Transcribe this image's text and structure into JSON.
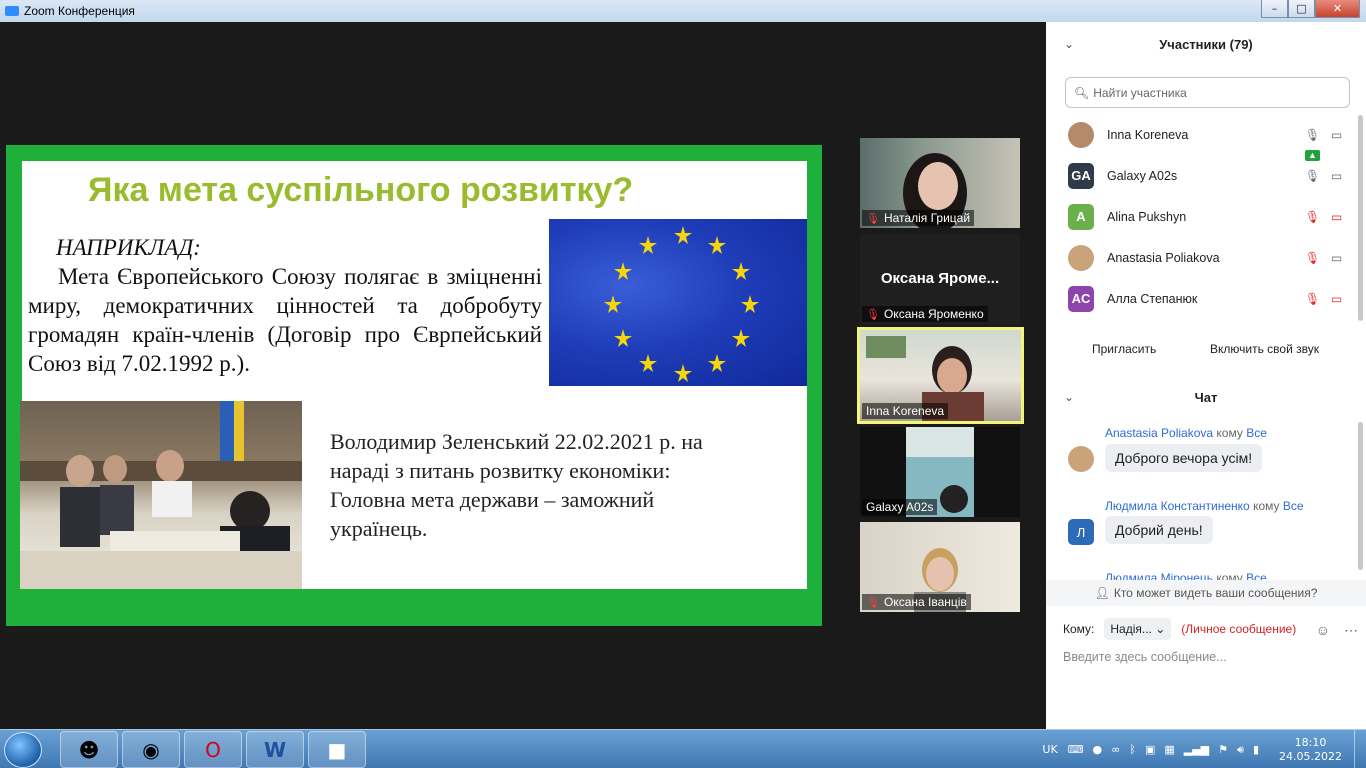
{
  "window": {
    "title": "Zoom Конференция",
    "min": "–",
    "max": "□",
    "close": "✕"
  },
  "slide": {
    "title": "Яка мета суспільного розвитку?",
    "lead": "НАПРИКЛАД:",
    "body": "Мета Європейського Союзу полягає в зміцненні миру, демократичних цінностей та добробуту громадян країн-членів (Договір про Єврпейський Союз від 7.02.1992 р.).",
    "quote": "Володимир Зеленський 22.02.2021 р. на нараді з питань розвитку економіки: Головна мета держави – заможний українець."
  },
  "gallery": [
    {
      "name": "Наталія Грицай",
      "muted": true
    },
    {
      "name": "Оксана  Яроменко",
      "big": "Оксана  Яроме...",
      "muted": true
    },
    {
      "name": "Inna Koreneva",
      "muted": false,
      "active": true
    },
    {
      "name": "Galaxy A02s",
      "muted": false
    },
    {
      "name": "Оксана Іванців",
      "muted": true
    }
  ],
  "participants": {
    "header": "Участники (79)",
    "search_placeholder": "Найти участника",
    "list": [
      {
        "initials": "",
        "name": "Inna Koreneva",
        "color": "#b48a6a"
      },
      {
        "initials": "GA",
        "name": "Galaxy A02s",
        "color": "#2f3b48"
      },
      {
        "initials": "A",
        "name": "Alina Pukshyn",
        "color": "#6ab04c"
      },
      {
        "initials": "",
        "name": "Anastasia Poliakova",
        "color": "#caa37a"
      },
      {
        "initials": "AC",
        "name": "Алла Степанюк",
        "color": "#8e44ad"
      }
    ],
    "invite": "Пригласить",
    "unmute": "Включить свой звук"
  },
  "chat": {
    "header": "Чат",
    "messages": [
      {
        "from": "Anastasia Poliakova",
        "to_word": "кому",
        "to": "Все",
        "text": "Доброго вечора усім!"
      },
      {
        "from": "Людмила Константиненко",
        "to_word": "кому",
        "to": "Все",
        "text": "Добрий день!",
        "initial": "Л"
      },
      {
        "from": "Людмила Міронець",
        "to_word": "кому",
        "to": "Все"
      }
    ],
    "who_sees": "Кто может видеть ваши сообщения?",
    "to_label": "Кому:",
    "to_value": "Надія...",
    "private": "(Личное сообщение)",
    "placeholder": "Введите здесь сообщение..."
  },
  "taskbar": {
    "lang": "UK",
    "time": "18:10",
    "date": "24.05.2022"
  }
}
